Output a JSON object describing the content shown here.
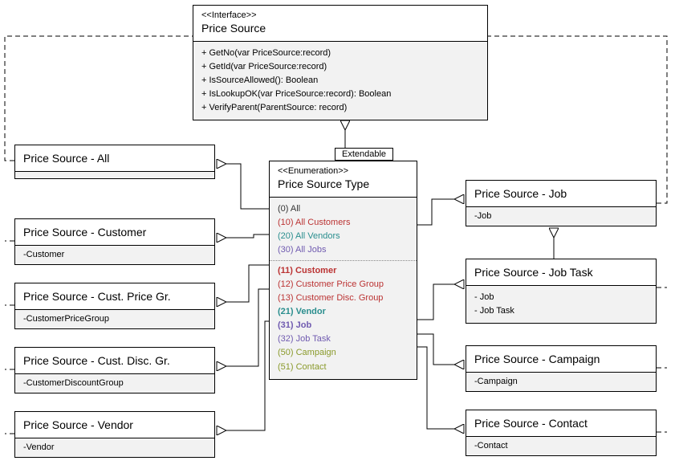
{
  "interface": {
    "stereo": "<<Interface>>",
    "title": "Price Source",
    "methods": [
      "+ GetNo(var PriceSource:record)",
      "+ GetId(var PriceSource:record)",
      "+ IsSourceAllowed(): Boolean",
      "+ IsLookupOK(var PriceSource:record): Boolean",
      "+ VerifyParent(ParentSource: record)"
    ]
  },
  "extendable_tag": "Extendable",
  "enum": {
    "stereo": "<<Enumeration>>",
    "title": "Price Source Type",
    "top_values": [
      {
        "text": "(0) All",
        "cls": "c-black"
      },
      {
        "text": "(10) All Customers",
        "cls": "c-red"
      },
      {
        "text": "(20) All Vendors",
        "cls": "c-teal"
      },
      {
        "text": "(30) All Jobs",
        "cls": "c-purple"
      }
    ],
    "bottom_values": [
      {
        "text": "(11) Customer",
        "cls": "c-red",
        "bold": true
      },
      {
        "text": "(12) Customer Price Group",
        "cls": "c-red"
      },
      {
        "text": "(13) Customer Disc. Group",
        "cls": "c-red"
      },
      {
        "text": "(21) Vendor",
        "cls": "c-teal",
        "bold": true
      },
      {
        "text": "(31) Job",
        "cls": "c-purple",
        "bold": true
      },
      {
        "text": "(32) Job Task",
        "cls": "c-purple"
      },
      {
        "text": "(50) Campaign",
        "cls": "c-olive"
      },
      {
        "text": "(51) Contact",
        "cls": "c-olive"
      }
    ]
  },
  "classes_left": [
    {
      "title": "Price Source - All",
      "body": ""
    },
    {
      "title": "Price Source - Customer",
      "body": "-Customer"
    },
    {
      "title": "Price Source - Cust. Price Gr.",
      "body": "-CustomerPriceGroup"
    },
    {
      "title": "Price Source - Cust. Disc. Gr.",
      "body": "-CustomerDiscountGroup"
    },
    {
      "title": "Price Source - Vendor",
      "body": "-Vendor"
    }
  ],
  "classes_right": [
    {
      "title": "Price Source - Job",
      "body": "-Job"
    },
    {
      "title": "Price Source - Job Task",
      "body_lines": [
        "- Job",
        "- Job Task"
      ]
    },
    {
      "title": "Price Source - Campaign",
      "body": "-Campaign"
    },
    {
      "title": "Price Source - Contact",
      "body": "-Contact"
    }
  ]
}
